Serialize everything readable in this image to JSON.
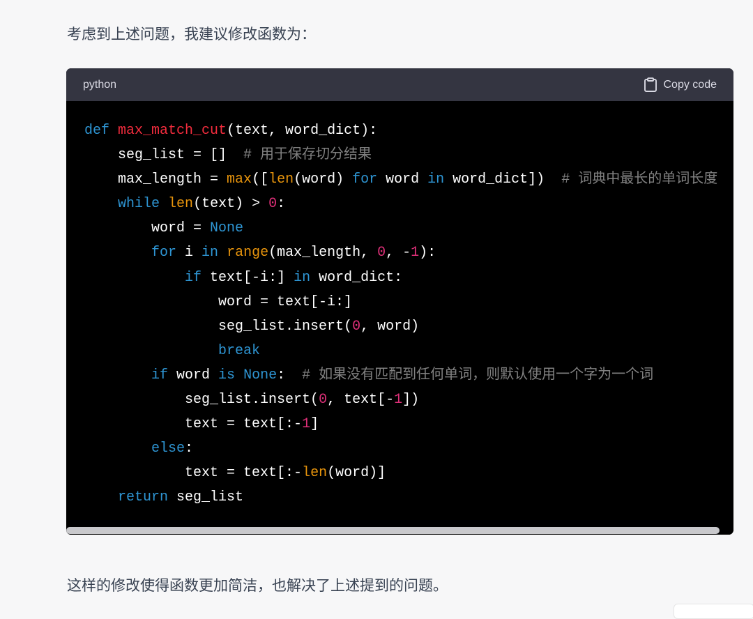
{
  "intro_text": "考虑到上述问题，我建议修改函数为：",
  "outro_text": "这样的修改使得函数更加简洁，也解决了上述提到的问题。",
  "code_block": {
    "language": "python",
    "copy_label": "Copy code",
    "lines": [
      [
        [
          "def ",
          "kw"
        ],
        [
          "max_match_cut",
          "fn"
        ],
        [
          "(text, word_dict):",
          ""
        ]
      ],
      [
        [
          "    seg_list = []  ",
          ""
        ],
        [
          "# 用于保存切分结果",
          "cm"
        ]
      ],
      [
        [
          "    max_length = ",
          ""
        ],
        [
          "max",
          "bi"
        ],
        [
          "([",
          ""
        ],
        [
          "len",
          "bi"
        ],
        [
          "(word) ",
          ""
        ],
        [
          "for",
          "kw"
        ],
        [
          " word ",
          ""
        ],
        [
          "in",
          "kw"
        ],
        [
          " word_dict])  ",
          ""
        ],
        [
          "# 词典中最长的单词长度",
          "cm"
        ]
      ],
      [
        [
          "    ",
          ""
        ],
        [
          "while",
          "kw"
        ],
        [
          " ",
          ""
        ],
        [
          "len",
          "bi"
        ],
        [
          "(text) > ",
          ""
        ],
        [
          "0",
          "num"
        ],
        [
          ":",
          ""
        ]
      ],
      [
        [
          "        word = ",
          ""
        ],
        [
          "None",
          "kw"
        ]
      ],
      [
        [
          "        ",
          ""
        ],
        [
          "for",
          "kw"
        ],
        [
          " i ",
          ""
        ],
        [
          "in",
          "kw"
        ],
        [
          " ",
          ""
        ],
        [
          "range",
          "bi"
        ],
        [
          "(max_length, ",
          ""
        ],
        [
          "0",
          "num"
        ],
        [
          ", -",
          ""
        ],
        [
          "1",
          "num"
        ],
        [
          "):",
          ""
        ]
      ],
      [
        [
          "            ",
          ""
        ],
        [
          "if",
          "kw"
        ],
        [
          " text[-i:] ",
          ""
        ],
        [
          "in",
          "kw"
        ],
        [
          " word_dict:",
          ""
        ]
      ],
      [
        [
          "                word = text[-i:]",
          ""
        ]
      ],
      [
        [
          "                seg_list.insert(",
          ""
        ],
        [
          "0",
          "num"
        ],
        [
          ", word)",
          ""
        ]
      ],
      [
        [
          "                ",
          ""
        ],
        [
          "break",
          "kw"
        ]
      ],
      [
        [
          "        ",
          ""
        ],
        [
          "if",
          "kw"
        ],
        [
          " word ",
          ""
        ],
        [
          "is",
          "kw"
        ],
        [
          " ",
          ""
        ],
        [
          "None",
          "kw"
        ],
        [
          ":  ",
          ""
        ],
        [
          "# 如果没有匹配到任何单词，则默认使用一个字为一个词",
          "cm"
        ]
      ],
      [
        [
          "            seg_list.insert(",
          ""
        ],
        [
          "0",
          "num"
        ],
        [
          ", text[-",
          ""
        ],
        [
          "1",
          "num"
        ],
        [
          "])",
          ""
        ]
      ],
      [
        [
          "            text = text[:-",
          ""
        ],
        [
          "1",
          "num"
        ],
        [
          "]",
          ""
        ]
      ],
      [
        [
          "        ",
          ""
        ],
        [
          "else",
          "kw"
        ],
        [
          ":",
          ""
        ]
      ],
      [
        [
          "            text = text[:-",
          ""
        ],
        [
          "len",
          "bi"
        ],
        [
          "(word)]",
          ""
        ]
      ],
      [
        [
          "    ",
          ""
        ],
        [
          "return",
          "kw"
        ],
        [
          " seg_list",
          ""
        ]
      ]
    ]
  },
  "colors": {
    "page_background": "#f7f7f8",
    "header_background": "#343541",
    "code_background": "#000000",
    "keyword": "#2e95d3",
    "function_name": "#f22c3d",
    "builtin": "#e9950c",
    "number": "#df3079",
    "comment": "rgba(255,255,255,0.5)"
  },
  "icons": {
    "copy": "clipboard-icon"
  }
}
